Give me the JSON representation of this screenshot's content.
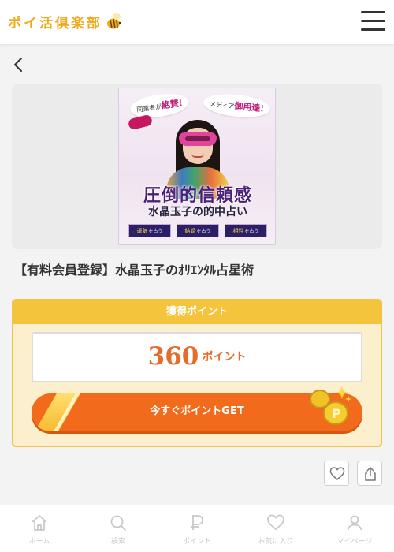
{
  "header": {
    "logo_text": "ポイ活倶楽部",
    "menu_icon": "hamburger-icon"
  },
  "nav_back_icon": "chevron-left-icon",
  "banner": {
    "bubble_left_pre": "同業者が",
    "bubble_left_em": "絶賛!",
    "bubble_right_pre": "メディア",
    "bubble_right_em": "御用達!",
    "catch_main": "圧倒的信頼感",
    "catch_sub": "水晶玉子の的中占い",
    "tags": [
      {
        "main": "運気",
        "sub": "を占う"
      },
      {
        "main": "結婚",
        "sub": "を占う"
      },
      {
        "main": "相性",
        "sub": "を占う"
      }
    ]
  },
  "offer": {
    "title": "【有料会員登録】水晶玉子のｵﾘｴﾝﾀﾙ占星術"
  },
  "points": {
    "header": "獲得ポイント",
    "value": "360",
    "unit": "ポイント",
    "button_label": "今すぐポイントGET"
  },
  "actions": {
    "favorite_icon": "heart-icon",
    "share_icon": "share-icon"
  },
  "bottom_nav": [
    {
      "label": "ホーム",
      "icon": "home-icon"
    },
    {
      "label": "検索",
      "icon": "search-icon"
    },
    {
      "label": "ポイント",
      "icon": "point-icon"
    },
    {
      "label": "お気に入り",
      "icon": "heart-icon"
    },
    {
      "label": "マイページ",
      "icon": "user-icon"
    }
  ],
  "colors": {
    "brand_yellow": "#f5c43d",
    "accent_orange": "#e46d2b",
    "button_orange": "#f26b1d"
  }
}
